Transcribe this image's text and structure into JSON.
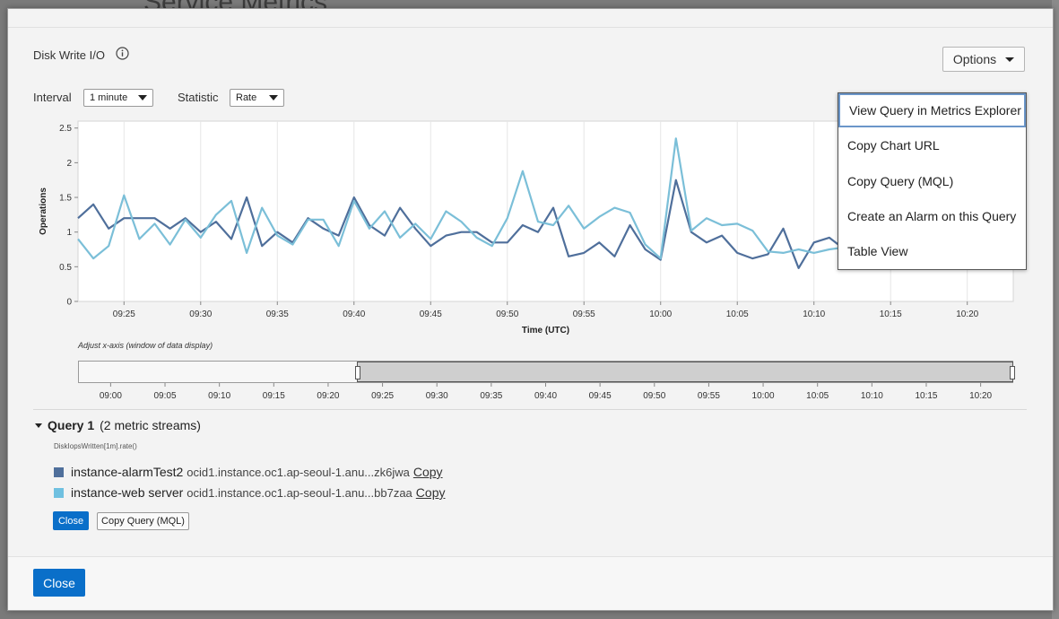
{
  "background": {
    "page_title": "Service Metrics"
  },
  "chart_panel": {
    "title": "Disk Write I/O",
    "options_label": "Options",
    "interval_label": "Interval",
    "interval_value": "1 minute",
    "statistic_label": "Statistic",
    "statistic_value": "Rate"
  },
  "options_menu": {
    "items": [
      "View Query in Metrics Explorer",
      "Copy Chart URL",
      "Copy Query (MQL)",
      "Create an Alarm on this Query",
      "Table View"
    ]
  },
  "chart_data": {
    "type": "line",
    "xlabel": "Time (UTC)",
    "ylabel": "Operations",
    "ylim": [
      0,
      2.6
    ],
    "yticks": [
      "0",
      "0.5",
      "1",
      "1.5",
      "2",
      "2.5"
    ],
    "xlim": [
      "09:22",
      "10:23"
    ],
    "xticks": [
      "09:25",
      "09:30",
      "09:35",
      "09:40",
      "09:45",
      "09:50",
      "09:55",
      "10:00",
      "10:05",
      "10:10",
      "10:15",
      "10:20"
    ],
    "grid": "vertical",
    "x": [
      "09:22",
      "09:23",
      "09:24",
      "09:25",
      "09:26",
      "09:27",
      "09:28",
      "09:29",
      "09:30",
      "09:31",
      "09:32",
      "09:33",
      "09:34",
      "09:35",
      "09:36",
      "09:37",
      "09:38",
      "09:39",
      "09:40",
      "09:41",
      "09:42",
      "09:43",
      "09:44",
      "09:45",
      "09:46",
      "09:47",
      "09:48",
      "09:49",
      "09:50",
      "09:51",
      "09:52",
      "09:53",
      "09:54",
      "09:55",
      "09:56",
      "09:57",
      "09:58",
      "09:59",
      "10:00",
      "10:01",
      "10:02",
      "10:03",
      "10:04",
      "10:05",
      "10:06",
      "10:07",
      "10:08",
      "10:09",
      "10:10",
      "10:11",
      "10:12"
    ],
    "series": [
      {
        "name": "instance-alarmTest2",
        "color": "#4f6f9b",
        "values": [
          1.2,
          1.4,
          1.05,
          1.2,
          1.2,
          1.2,
          1.05,
          1.2,
          1.0,
          1.15,
          0.9,
          1.5,
          0.8,
          1.0,
          0.85,
          1.2,
          1.05,
          0.95,
          1.5,
          1.1,
          0.95,
          1.35,
          1.05,
          0.8,
          0.95,
          1.0,
          1.0,
          0.85,
          0.85,
          1.1,
          1.0,
          1.35,
          0.65,
          0.7,
          0.85,
          0.65,
          1.1,
          0.75,
          0.6,
          1.75,
          1.0,
          0.85,
          0.95,
          0.7,
          0.62,
          0.68,
          1.05,
          0.48,
          0.85,
          0.92,
          0.75
        ]
      },
      {
        "name": "instance-web server",
        "color": "#7bbfd8",
        "values": [
          0.9,
          0.62,
          0.8,
          1.53,
          0.9,
          1.12,
          0.82,
          1.18,
          0.92,
          1.25,
          1.45,
          0.7,
          1.35,
          0.95,
          0.82,
          1.18,
          1.18,
          0.8,
          1.45,
          1.05,
          1.3,
          0.92,
          1.12,
          0.9,
          1.3,
          1.15,
          0.92,
          0.8,
          1.2,
          1.88,
          1.15,
          1.1,
          1.38,
          1.05,
          1.22,
          1.35,
          1.28,
          0.82,
          0.62,
          2.35,
          1.02,
          1.2,
          1.1,
          1.12,
          1.02,
          0.72,
          0.7,
          0.75,
          0.7,
          0.75,
          0.78
        ]
      }
    ]
  },
  "range_selector": {
    "caption": "Adjust x-axis (window of data display)",
    "ticks": [
      "09:00",
      "09:05",
      "09:10",
      "09:15",
      "09:20",
      "09:25",
      "09:30",
      "09:35",
      "09:40",
      "09:45",
      "09:50",
      "09:55",
      "10:00",
      "10:05",
      "10:10",
      "10:15",
      "10:20"
    ]
  },
  "query": {
    "title": "Query 1",
    "subtitle": "(2 metric streams)",
    "mql": "DiskIopsWritten[1m].rate()",
    "streams": [
      {
        "name": "instance-alarmTest2",
        "ocid": "ocid1.instance.oc1.ap-seoul-1.anu...zk6jwa",
        "copy_label": "Copy",
        "color": "#4f6f9b"
      },
      {
        "name": "instance-web server",
        "ocid": "ocid1.instance.oc1.ap-seoul-1.anu...bb7zaa",
        "copy_label": "Copy",
        "color": "#6fc0e0"
      }
    ],
    "close_label": "Close",
    "copy_query_label": "Copy Query (MQL)"
  },
  "footer": {
    "close_label": "Close"
  }
}
